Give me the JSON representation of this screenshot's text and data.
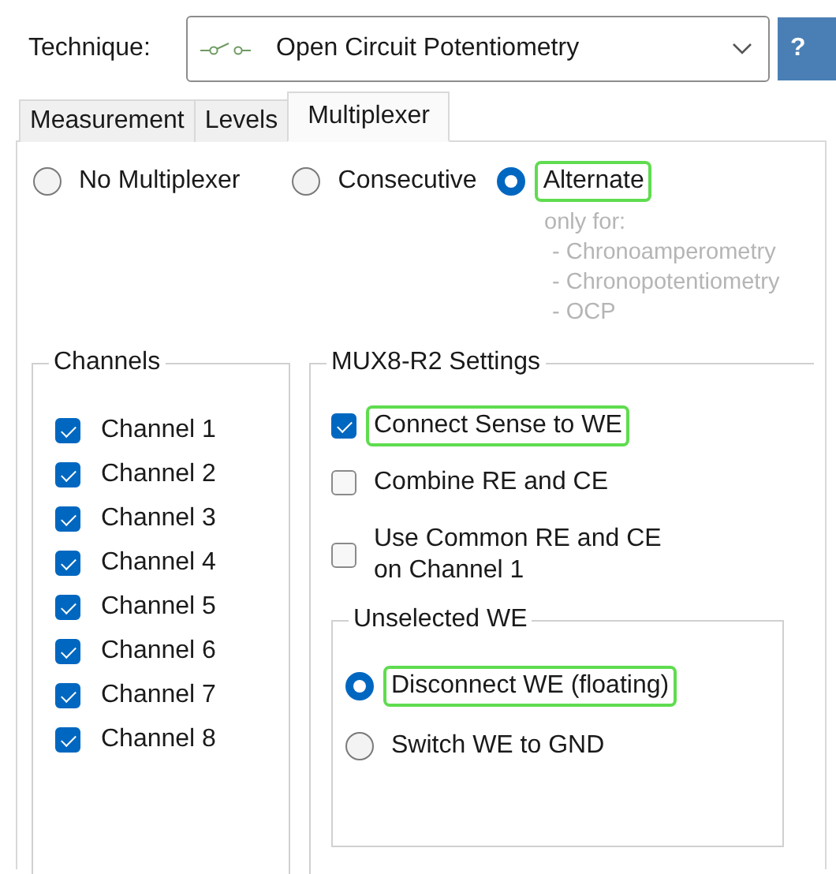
{
  "technique": {
    "label": "Technique:",
    "value": "Open Circuit Potentiometry"
  },
  "help_button": "?",
  "tabs": [
    {
      "label": "Measurement",
      "selected": false
    },
    {
      "label": "Levels",
      "selected": false
    },
    {
      "label": "Multiplexer",
      "selected": true
    }
  ],
  "mode_options": [
    {
      "label": "No Multiplexer",
      "selected": false,
      "highlighted": false
    },
    {
      "label": "Consecutive",
      "selected": false,
      "highlighted": false
    },
    {
      "label": "Alternate",
      "selected": true,
      "highlighted": true
    }
  ],
  "mode_note": [
    "only for:",
    "- Chronoamperometry",
    "- Chronopotentiometry",
    "- OCP"
  ],
  "channels": {
    "title": "Channels",
    "items": [
      {
        "label": "Channel 1",
        "checked": true
      },
      {
        "label": "Channel 2",
        "checked": true
      },
      {
        "label": "Channel 3",
        "checked": true
      },
      {
        "label": "Channel 4",
        "checked": true
      },
      {
        "label": "Channel 5",
        "checked": true
      },
      {
        "label": "Channel 6",
        "checked": true
      },
      {
        "label": "Channel 7",
        "checked": true
      },
      {
        "label": "Channel 8",
        "checked": true
      }
    ]
  },
  "mux_settings": {
    "title": "MUX8-R2 Settings",
    "options": [
      {
        "label": "Connect Sense to WE",
        "checked": true,
        "highlighted": true
      },
      {
        "label": "Combine RE and CE",
        "checked": false,
        "highlighted": false
      },
      {
        "label": "Use Common RE and CE\non Channel 1",
        "checked": false,
        "highlighted": false
      }
    ],
    "unselected_we": {
      "title": "Unselected WE",
      "options": [
        {
          "label": "Disconnect WE (floating)",
          "selected": true,
          "highlighted": true
        },
        {
          "label": "Switch WE to GND",
          "selected": false,
          "highlighted": false
        }
      ]
    }
  }
}
